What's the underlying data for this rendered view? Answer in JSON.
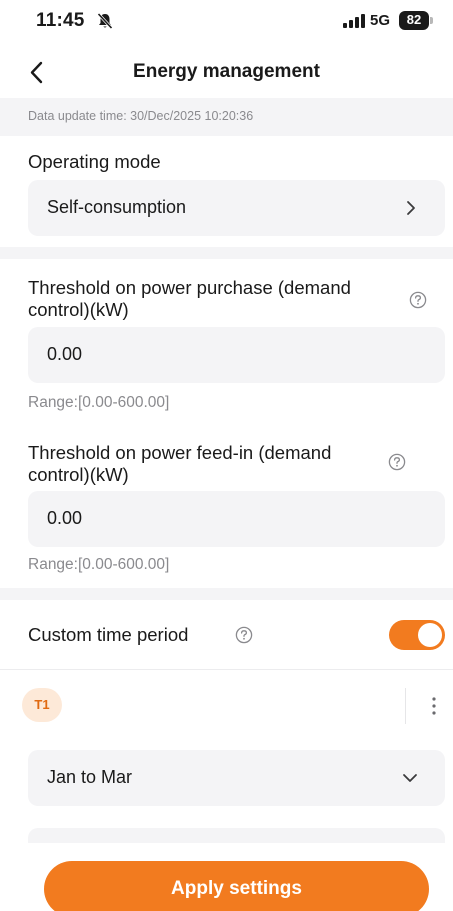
{
  "status_bar": {
    "time": "11:45",
    "network": "5G",
    "battery": "82"
  },
  "nav": {
    "title": "Energy management"
  },
  "update": {
    "text": "Data update time: 30/Dec/2025 10:20:36"
  },
  "operating_mode": {
    "label": "Operating mode",
    "value": "Self-consumption"
  },
  "purchase_threshold": {
    "label_line1": "Threshold on power purchase (demand",
    "label_line2": "control)(kW)",
    "value": "0.00",
    "range": "Range:[0.00-600.00]"
  },
  "feedin_threshold": {
    "label_line1": "Threshold on power feed-in (demand",
    "label_line2": "control)(kW)",
    "value": "0.00",
    "range": "Range:[0.00-600.00]"
  },
  "custom_period": {
    "label": "Custom time period",
    "enabled": true
  },
  "period": {
    "badge": "T1",
    "months": "Jan to Mar"
  },
  "actions": {
    "apply_label": "Apply settings"
  },
  "colors": {
    "accent": "#f27b1f",
    "badge_bg": "#fde9d8",
    "field_bg": "#f4f4f6"
  }
}
